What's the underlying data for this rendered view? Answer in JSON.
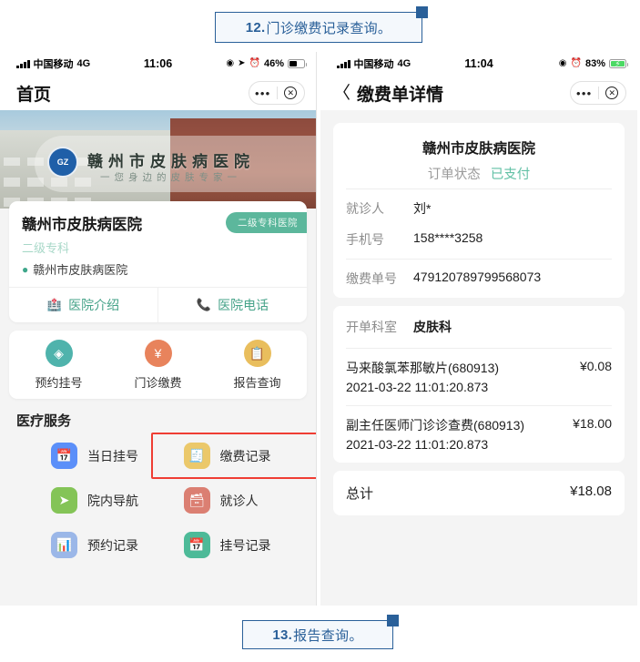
{
  "captions": {
    "top": {
      "num": "12.",
      "text": "门诊缴费记录查询。"
    },
    "bottom": {
      "num": "13.",
      "text": "报告查询。"
    }
  },
  "left_phone": {
    "status_bar": {
      "carrier": "中国移动",
      "network": "4G",
      "time": "11:06",
      "battery_pct": "46%",
      "location_icon": "location-arrow-icon",
      "alarm_icon": "alarm-clock-icon",
      "compass_icon": "compass-icon"
    },
    "nav": {
      "title": "首页",
      "more_label": "•••",
      "close_label": "✕"
    },
    "banner": {
      "title": "赣州市皮肤病医院",
      "subtitle": "一您身边的皮肤专家一",
      "logo_text": "GZ"
    },
    "hospital_card": {
      "name": "赣州市皮肤病医院",
      "badge": "二级专科医院",
      "level": "二级专科",
      "address": "赣州市皮肤病医院",
      "actions": [
        {
          "label": "医院介绍",
          "icon": "hospital-icon"
        },
        {
          "label": "医院电话",
          "icon": "phone-icon"
        }
      ]
    },
    "quick_actions": [
      {
        "label": "预约挂号",
        "icon": "appointment-icon",
        "color": "#4FB3AC",
        "glyph": "◆"
      },
      {
        "label": "门诊缴费",
        "icon": "payment-shield-icon",
        "color": "#E8835C",
        "glyph": "¥"
      },
      {
        "label": "报告查询",
        "icon": "report-clipboard-icon",
        "color": "#E9BE5D",
        "glyph": "▤"
      }
    ],
    "services": {
      "title": "医疗服务",
      "items": [
        {
          "label": "当日挂号",
          "icon": "calendar-plus-icon",
          "color": "#5B8FF9",
          "glyph": "▤",
          "highlight": false
        },
        {
          "label": "缴费记录",
          "icon": "payment-record-icon",
          "color": "#EBC86A",
          "glyph": "▤",
          "highlight": true
        },
        {
          "label": "院内导航",
          "icon": "navigation-arrow-icon",
          "color": "#84C457",
          "glyph": "➤",
          "highlight": false
        },
        {
          "label": "就诊人",
          "icon": "patient-card-icon",
          "color": "#DB7F72",
          "glyph": "▤",
          "highlight": false
        },
        {
          "label": "预约记录",
          "icon": "appointment-record-icon",
          "color": "#9BB7E8",
          "glyph": "▤",
          "highlight": false
        },
        {
          "label": "挂号记录",
          "icon": "register-record-icon",
          "color": "#4DBA98",
          "glyph": "▤",
          "highlight": false
        }
      ]
    }
  },
  "right_phone": {
    "status_bar": {
      "carrier": "中国移动",
      "network": "4G",
      "time": "11:04",
      "battery_pct": "83%",
      "charging": true,
      "alarm_icon": "alarm-clock-icon",
      "compass_icon": "compass-icon"
    },
    "nav": {
      "back_icon": "back-chevron-icon",
      "title": "缴费单详情",
      "more_label": "•••",
      "close_label": "✕"
    },
    "order": {
      "hospital": "赣州市皮肤病医院",
      "status_label": "订单状态",
      "status_value": "已支付",
      "fields": [
        {
          "key": "就诊人",
          "value": "刘*"
        },
        {
          "key": "手机号",
          "value": "158****3258"
        }
      ],
      "order_no_key": "缴费单号",
      "order_no_value": "479120789799568073"
    },
    "detail": {
      "dept_key": "开单科室",
      "dept_value": "皮肤科",
      "items": [
        {
          "name": "马来酸氯苯那敏片(680913)",
          "amount": "¥0.08",
          "time": "2021-03-22 11:01:20.873"
        },
        {
          "name": "副主任医师门诊诊查费(680913)",
          "amount": "¥18.00",
          "time": "2021-03-22 11:01:20.873"
        }
      ]
    },
    "total": {
      "label": "总计",
      "value": "¥18.08"
    }
  }
}
